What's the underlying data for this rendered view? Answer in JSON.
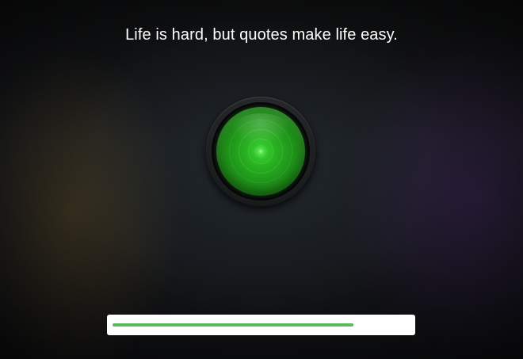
{
  "quote": {
    "text": "Life is hard, but quotes make life easy."
  },
  "light": {
    "icon": "green-light-button",
    "color": "#2fae2a",
    "state": "on"
  },
  "progress": {
    "value": 0.81,
    "fill_color": "#5cb95c",
    "track_color": "#ffffff"
  }
}
